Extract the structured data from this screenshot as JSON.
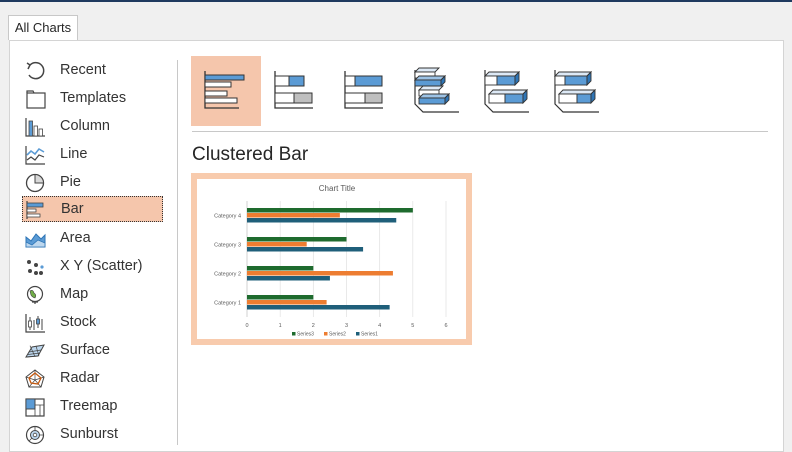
{
  "tab": {
    "label": "All Charts"
  },
  "sidebar": {
    "items": [
      {
        "label": "Recent"
      },
      {
        "label": "Templates"
      },
      {
        "label": "Column"
      },
      {
        "label": "Line"
      },
      {
        "label": "Pie"
      },
      {
        "label": "Bar",
        "selected": true
      },
      {
        "label": "Area"
      },
      {
        "label": "X Y (Scatter)"
      },
      {
        "label": "Map"
      },
      {
        "label": "Stock"
      },
      {
        "label": "Surface"
      },
      {
        "label": "Radar"
      },
      {
        "label": "Treemap"
      },
      {
        "label": "Sunburst"
      }
    ]
  },
  "subtypes": [
    {
      "icon": "clustered-bar-icon",
      "selected": true
    },
    {
      "icon": "stacked-bar-icon"
    },
    {
      "icon": "100-percent-stacked-bar-icon"
    },
    {
      "icon": "3d-clustered-bar-icon"
    },
    {
      "icon": "3d-stacked-bar-icon"
    },
    {
      "icon": "3d-100-percent-stacked-bar-icon"
    }
  ],
  "section_title": "Clustered Bar",
  "colors": {
    "accent": "#f5c6ac",
    "series1": "#1f5f7a",
    "series2": "#ed7d31",
    "series3": "#1e6b2e",
    "icon_blue": "#5b9bd5"
  },
  "chart_data": {
    "type": "bar",
    "orientation": "horizontal",
    "title": "Chart Title",
    "categories": [
      "Category 1",
      "Category 2",
      "Category 3",
      "Category 4"
    ],
    "series": [
      {
        "name": "Series 1",
        "color": "#1f5f7a",
        "values": [
          4.3,
          2.5,
          3.5,
          4.5
        ]
      },
      {
        "name": "Series 2",
        "color": "#ed7d31",
        "values": [
          2.4,
          4.4,
          1.8,
          2.8
        ]
      },
      {
        "name": "Series 3",
        "color": "#1e6b2e",
        "values": [
          2,
          2,
          3,
          5
        ]
      }
    ],
    "xticks": [
      "0",
      "1",
      "2",
      "3",
      "4",
      "5",
      "6"
    ],
    "xlim": [
      0,
      6
    ],
    "legend_order": [
      "Series3",
      "Series2",
      "Series1"
    ],
    "legend_position": "bottom",
    "grid": true
  }
}
